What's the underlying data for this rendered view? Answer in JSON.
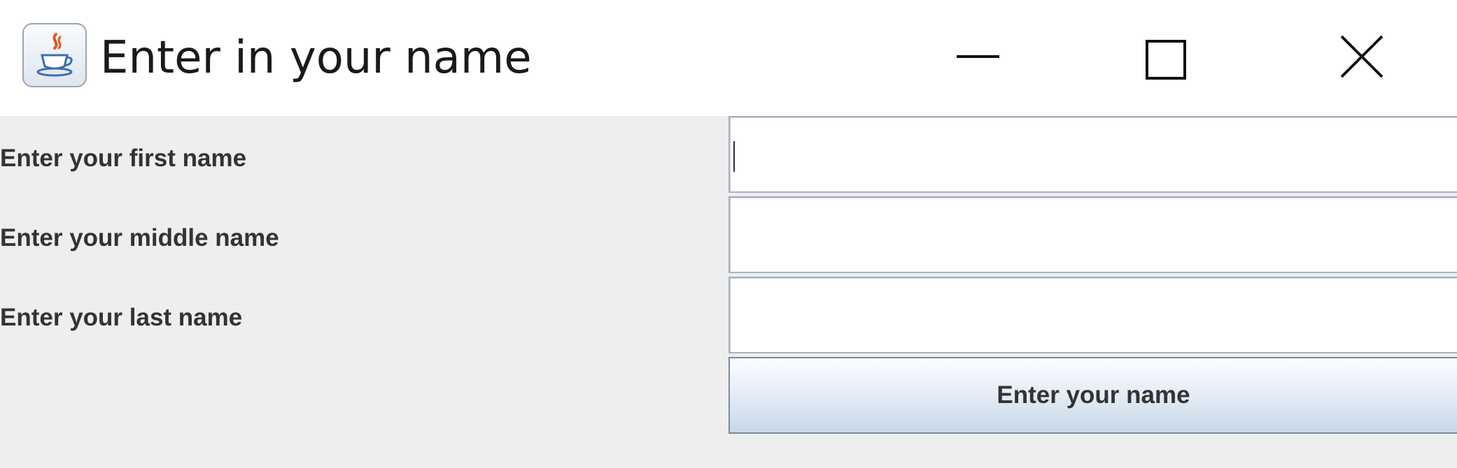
{
  "window": {
    "title": "Enter in your name",
    "icon": "java-cup-icon",
    "controls": {
      "minimize_icon": "minimize-icon",
      "maximize_icon": "maximize-icon",
      "close_icon": "close-icon"
    }
  },
  "form": {
    "first_name": {
      "label": "Enter your first name",
      "value": ""
    },
    "middle_name": {
      "label": "Enter your middle name",
      "value": ""
    },
    "last_name": {
      "label": "Enter your last name",
      "value": ""
    },
    "submit_label": "Enter your name"
  },
  "colors": {
    "panel_background": "#eeeeee",
    "label_text": "#333333",
    "field_border": "#a6b0bf",
    "button_gradient_top": "#fbfcfe",
    "button_gradient_bottom": "#c9d7e8"
  }
}
